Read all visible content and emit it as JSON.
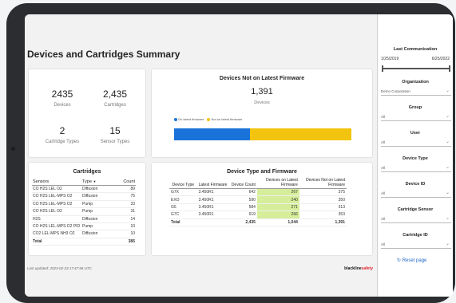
{
  "main": {
    "title": "Devices and Cartridges Summary",
    "kpis": [
      {
        "value": "2435",
        "label": "Devices"
      },
      {
        "value": "2,435",
        "label": "Cartridges"
      },
      {
        "value": "2",
        "label": "Cartridge Types"
      },
      {
        "value": "15",
        "label": "Sensor Types"
      }
    ],
    "firmware": {
      "title": "Devices Not on Latest Firmware",
      "value": "1,391",
      "unit": "Devices",
      "legend_on": "On latest firmware",
      "legend_not": "Not on latest firmware",
      "on_latest": 1044,
      "not_latest": 1391,
      "color_on": "#1a73d9",
      "color_not": "#f2c40f"
    },
    "cartridges": {
      "title": "Cartridges",
      "headers": [
        "Sensors",
        "Type",
        "Count"
      ],
      "rows": [
        [
          "CO H2S LEL O2",
          "Diffusion",
          "89"
        ],
        [
          "CO H2S LEL-MPS O2",
          "Diffusion",
          "75"
        ],
        [
          "CO H2S LEL-MPS O2",
          "Pump",
          "33"
        ],
        [
          "CO H2S LEL O2",
          "Pump",
          "31"
        ],
        [
          "H2S",
          "Diffusion",
          "14"
        ],
        [
          "CO H2S LEL-MPS O2 PID",
          "Pump",
          "10"
        ],
        [
          "CO2 LEL-MPS NH3 O2",
          "Diffusion",
          "10"
        ]
      ],
      "total_label": "Total",
      "total_value": "385"
    },
    "device_table": {
      "title": "Device Type and Firmware",
      "headers": [
        "Device Type",
        "Latest Firmware",
        "Device Count",
        "Devices on Latest Firmware",
        "Devices Not on Latest Firmware"
      ],
      "rows": [
        [
          "G7X",
          "3.450R1",
          "642",
          "267",
          "375"
        ],
        [
          "EXO",
          "3.450R1",
          "590",
          "240",
          "350"
        ],
        [
          "G6",
          "3.450R1",
          "584",
          "271",
          "313"
        ],
        [
          "G7C",
          "3.450R1",
          "619",
          "266",
          "353"
        ]
      ],
      "total": [
        "Total",
        "",
        "2,435",
        "1,044",
        "1,391"
      ]
    },
    "footer": "Last updated: 2023-02-23 17:47:56 UTC",
    "brand_a": "blackline",
    "brand_b": "safety"
  },
  "sidebar": {
    "last_comm_title": "Last Communication",
    "date_from": "1/25/2019",
    "date_to": "6/25/2022",
    "filters": [
      {
        "label": "Organization",
        "value": "Demo Corporation"
      },
      {
        "label": "Group",
        "value": "All"
      },
      {
        "label": "User",
        "value": "All"
      },
      {
        "label": "Device Type",
        "value": "All"
      },
      {
        "label": "Device ID",
        "value": "All"
      },
      {
        "label": "Cartridge Sensor",
        "value": "All"
      },
      {
        "label": "Cartridge ID",
        "value": "All"
      }
    ],
    "reset_icon": "reset-icon",
    "reset_label": "Reset page"
  },
  "icons": {
    "dropdown": "chevron-down-icon",
    "sort": "sort-desc-icon"
  }
}
